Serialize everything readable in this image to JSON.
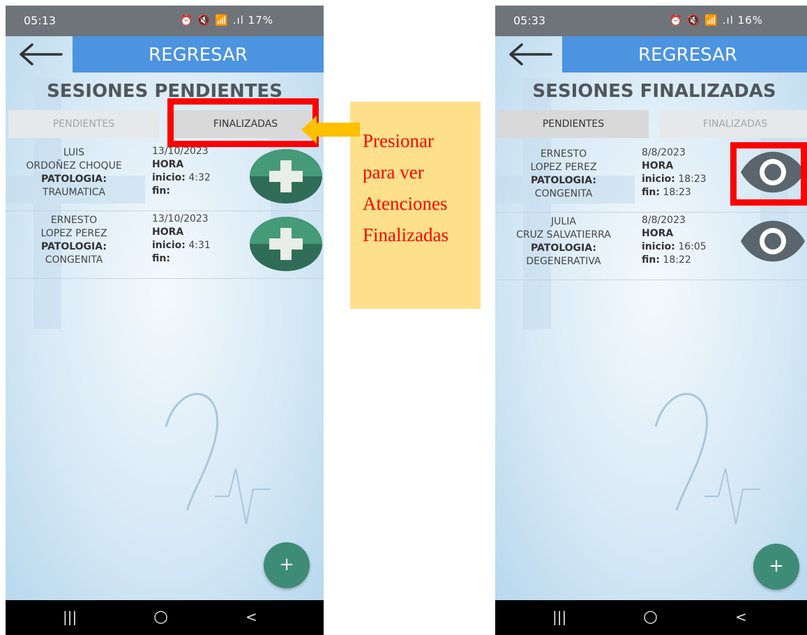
{
  "left_screen": {
    "status_time": "05:13",
    "status_icons": "⏰ 🔇 📶 .ıl 17%",
    "back_label": "REGRESAR",
    "title": "SESIONES PENDIENTES",
    "tabs": {
      "left": "PENDIENTES",
      "right": "FINALIZADAS"
    },
    "rows": [
      {
        "name1": "LUIS",
        "name2": "ORDOÑEZ CHOQUE",
        "pat_label": "PATOLOGIA:",
        "pat_value": "TRAUMATICA",
        "date": "13/10/2023",
        "hora": "HORA",
        "inicio_label": "inicio:",
        "inicio_value": "4:32",
        "fin_label": "fin:",
        "fin_value": ""
      },
      {
        "name1": "ERNESTO",
        "name2": "LOPEZ PEREZ",
        "pat_label": "PATOLOGIA:",
        "pat_value": "CONGENITA",
        "date": "13/10/2023",
        "hora": "HORA",
        "inicio_label": "inicio:",
        "inicio_value": "4:31",
        "fin_label": "fin:",
        "fin_value": ""
      }
    ],
    "fab": "+"
  },
  "right_screen": {
    "status_time": "05:33",
    "status_icons": "⏰ 🔇 📶 .ıl 16%",
    "back_label": "REGRESAR",
    "title": "SESIONES FINALIZADAS",
    "tabs": {
      "left": "PENDIENTES",
      "right": "FINALIZADAS"
    },
    "rows": [
      {
        "name1": "ERNESTO",
        "name2": "LOPEZ PEREZ",
        "pat_label": "PATOLOGIA:",
        "pat_value": "CONGENITA",
        "date": "8/8/2023",
        "hora": "HORA",
        "inicio_label": "inicio:",
        "inicio_value": "18:23",
        "fin_label": "fin:",
        "fin_value": "18:23"
      },
      {
        "name1": "JULIA",
        "name2": "CRUZ SALVATIERRA",
        "pat_label": "PATOLOGIA:",
        "pat_value": "DEGENERATIVA",
        "date": "8/8/2023",
        "hora": "HORA",
        "inicio_label": "inicio:",
        "inicio_value": "16:05",
        "fin_label": "fin:",
        "fin_value": "18:22"
      }
    ],
    "fab": "+"
  },
  "nav": {
    "recents": "|||",
    "home": "○",
    "back": "<"
  },
  "callout": {
    "line1": "Presionar",
    "line2": "para ver",
    "line3": "Atenciones",
    "line4": "Finalizadas"
  },
  "colors": {
    "accent_blue": "#4c93e0",
    "fab_green": "#3f8c76",
    "highlight_red": "#ff0000",
    "callout_bg": "#ffe08a",
    "arrow": "#ffc000"
  }
}
